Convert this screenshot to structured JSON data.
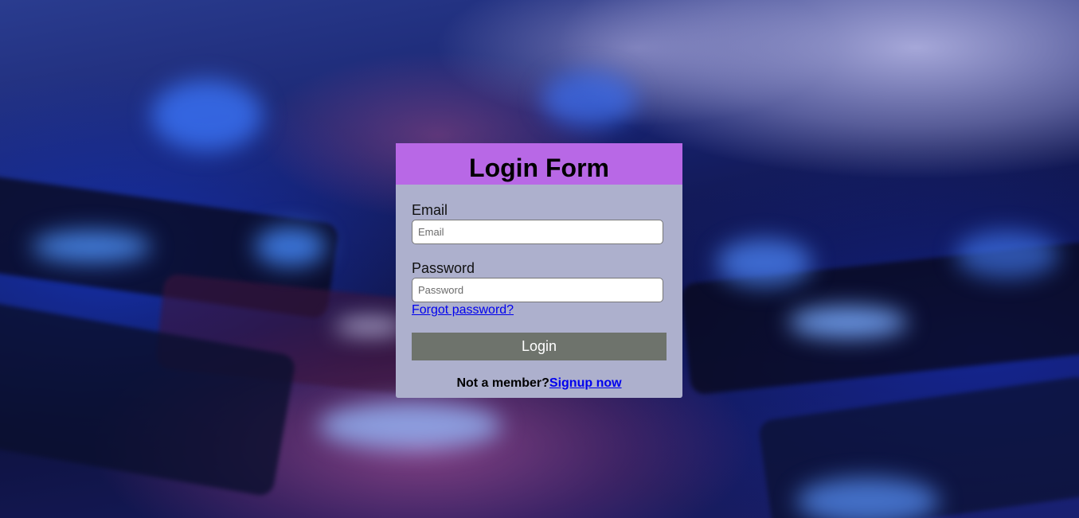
{
  "login_form": {
    "title": "Login Form",
    "email": {
      "label": "Email",
      "placeholder": "Email",
      "value": ""
    },
    "password": {
      "label": "Password",
      "placeholder": "Password",
      "value": ""
    },
    "forgot_password_link": "Forgot password?",
    "login_button": "Login",
    "signup_prompt": "Not a member?",
    "signup_link": "Signup now"
  },
  "colors": {
    "header_background": "#b868e6",
    "card_background": "#adb0cd",
    "button_background": "#6e736c",
    "link": "#0000ee"
  }
}
